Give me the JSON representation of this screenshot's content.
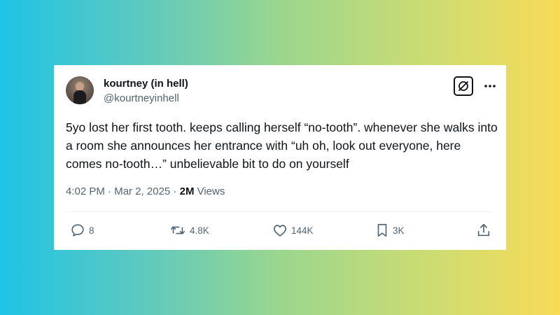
{
  "tweet": {
    "author": {
      "name": "kourtney (in hell)",
      "handle": "@kourtneyinhell"
    },
    "text": "5yo lost her first tooth. keeps calling herself “no-tooth”. whenever she walks into a room she announces her entrance with “uh oh, look out everyone, here comes no-tooth…” unbelievable bit to do on yourself",
    "time": "4:02 PM",
    "separator": " · ",
    "date": "Mar 2, 2025",
    "views_count": "2M",
    "views_label": " Views"
  },
  "actions": {
    "replies": "8",
    "reposts": "4.8K",
    "likes": "144K",
    "bookmarks": "3K"
  },
  "icons": {
    "grok": "grok-icon",
    "more": "more-icon",
    "reply": "reply-icon",
    "repost": "repost-icon",
    "like": "heart-icon",
    "bookmark": "bookmark-icon",
    "share": "share-icon"
  },
  "colors": {
    "text_primary": "#0f1419",
    "text_secondary": "#536471",
    "background_left": "#1ec3e6",
    "background_right": "#f8db57"
  }
}
